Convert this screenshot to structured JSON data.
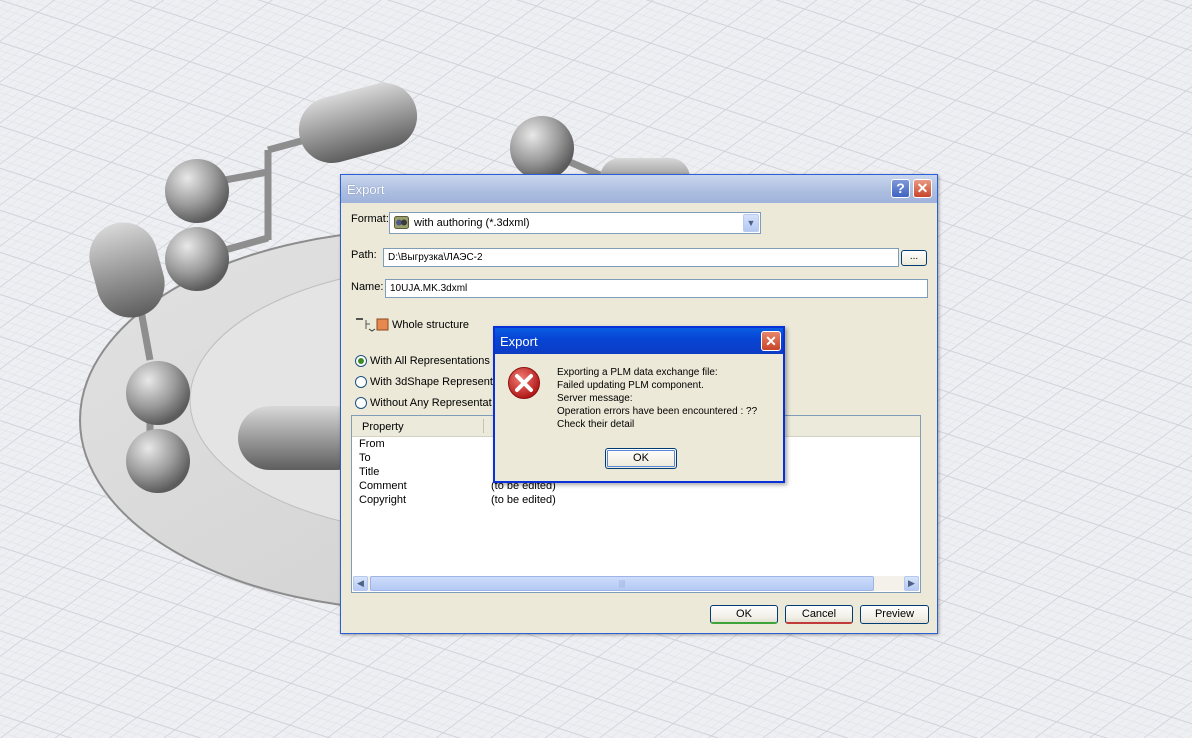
{
  "main_dialog": {
    "title": "Export",
    "help_label": "?",
    "close_label": "✕",
    "format_label": "Format:",
    "format_value": "with authoring (*.3dxml)",
    "path_label": "Path:",
    "path_value": "D:\\Выгрузка\\ЛАЭС-2",
    "browse_label": "...",
    "name_label": "Name:",
    "name_value": "10UJA.MK.3dxml",
    "structure_label": "Whole structure",
    "options": [
      {
        "label": "With All Representations",
        "selected": true
      },
      {
        "label": "With 3dShape Representa",
        "selected": false
      },
      {
        "label": "Without Any Representat",
        "selected": false
      }
    ],
    "table": {
      "header": "Property",
      "rows": [
        {
          "key": "From",
          "value": ""
        },
        {
          "key": "To",
          "value": ""
        },
        {
          "key": "Title",
          "value": ""
        },
        {
          "key": "Comment",
          "value": "(to be edited)"
        },
        {
          "key": "Copyright",
          "value": "(to be edited)"
        }
      ]
    },
    "ok_label": "OK",
    "cancel_label": "Cancel",
    "preview_label": "Preview"
  },
  "error_dialog": {
    "title": "Export",
    "close_label": "✕",
    "lines": [
      "Exporting a PLM data exchange file:",
      "Failed updating PLM component.",
      "Server message:",
      "Operation errors have been encountered : ??",
      "Check their detail"
    ],
    "ok_label": "OK"
  },
  "icons": [
    "error-icon",
    "format-icon",
    "structure-icon"
  ],
  "colors": {
    "title_active": "#0a5de2",
    "title_inactive": "#aebfe0",
    "dialog_bg": "#ece9d8",
    "error_red": "#c8242b"
  }
}
